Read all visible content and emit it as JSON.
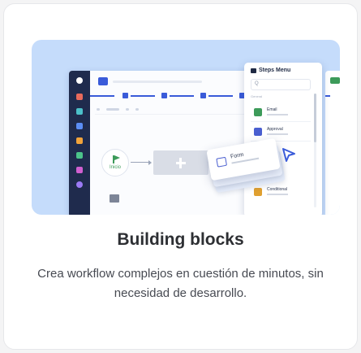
{
  "card": {
    "title": "Building blocks",
    "description": "Crea workflow complejos en cuestión de minutos, sin necesidad de desarrollo."
  },
  "illustration": {
    "steps_menu": {
      "title": "Steps Menu",
      "search_placeholder": "Q",
      "section_label": "General",
      "items": [
        {
          "label": "Email",
          "icon": "email-icon",
          "color": "#3d9b5a"
        },
        {
          "label": "Approval",
          "icon": "approval-icon",
          "color": "#4a5fd0"
        },
        {
          "label": "Conditional",
          "icon": "conditional-icon",
          "color": "#e0a030"
        }
      ]
    },
    "start_node_label": "Inicio",
    "dragged_block_label": "Form",
    "add_block_icon": "plus-icon",
    "cursor_icon": "pointer-arrow-icon",
    "sidebar_icons": [
      "logo-icon",
      "chart-icon",
      "inbox-icon",
      "calendar-icon",
      "briefcase-icon",
      "settings-icon",
      "stats-icon",
      "user-icon"
    ]
  },
  "colors": {
    "hero_background": "#c5dcfb",
    "accent": "#3a5bd9",
    "sidebar": "#1f2b4d",
    "title_text": "#2d2f33"
  }
}
